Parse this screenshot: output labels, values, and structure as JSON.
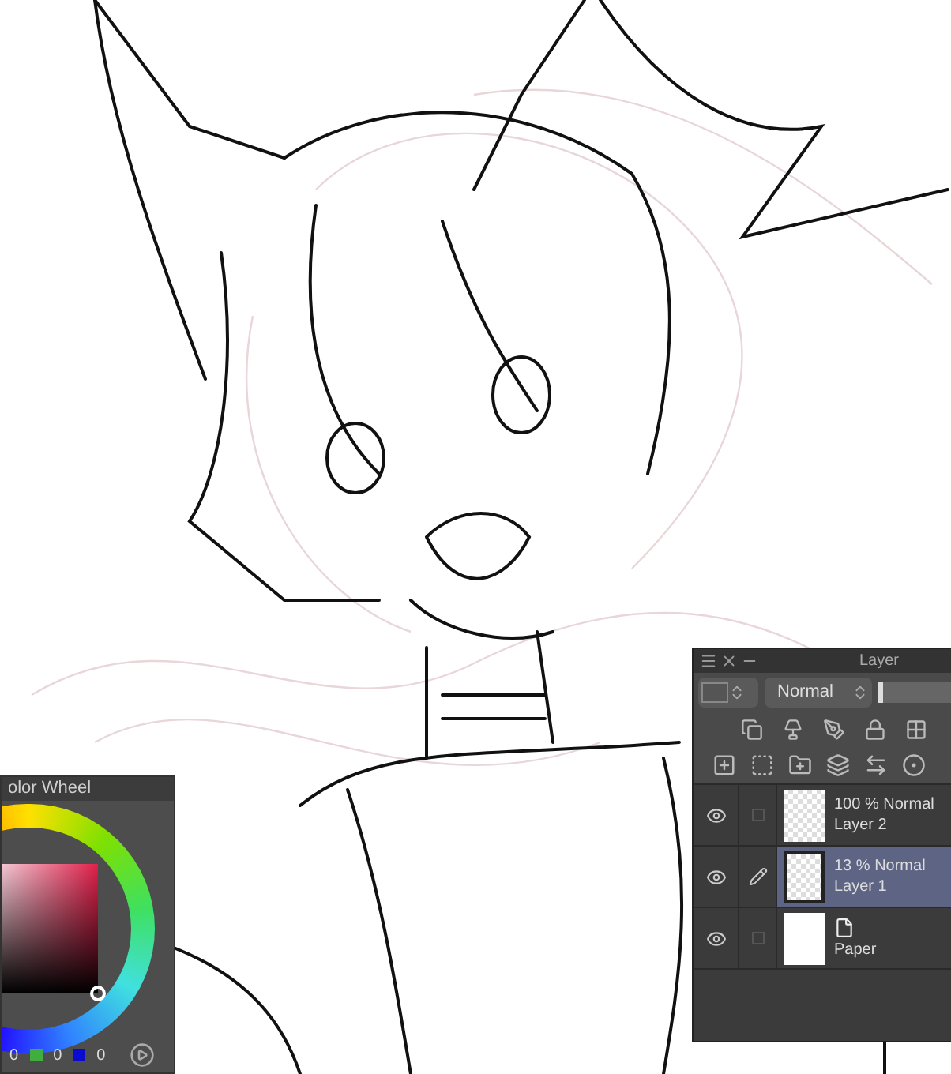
{
  "color_wheel": {
    "title": "olor Wheel",
    "channels": [
      {
        "value": "0"
      },
      {
        "value": "0",
        "color": "#3fae3f"
      },
      {
        "value": "0",
        "color": "#0a0ad0"
      }
    ]
  },
  "layer_panel": {
    "title": "Layer",
    "blend_mode": "Normal",
    "opacity": {
      "level": 0.06
    },
    "layers": [
      {
        "kind": "raster",
        "mode": "100 % Normal",
        "name": "Layer 2",
        "visible": true,
        "editing": false,
        "selected": false
      },
      {
        "kind": "raster",
        "mode": "13 % Normal",
        "name": "Layer 1",
        "visible": true,
        "editing": true,
        "selected": true
      },
      {
        "kind": "paper",
        "name": "Paper",
        "visible": true,
        "editing": false,
        "selected": false
      }
    ]
  }
}
